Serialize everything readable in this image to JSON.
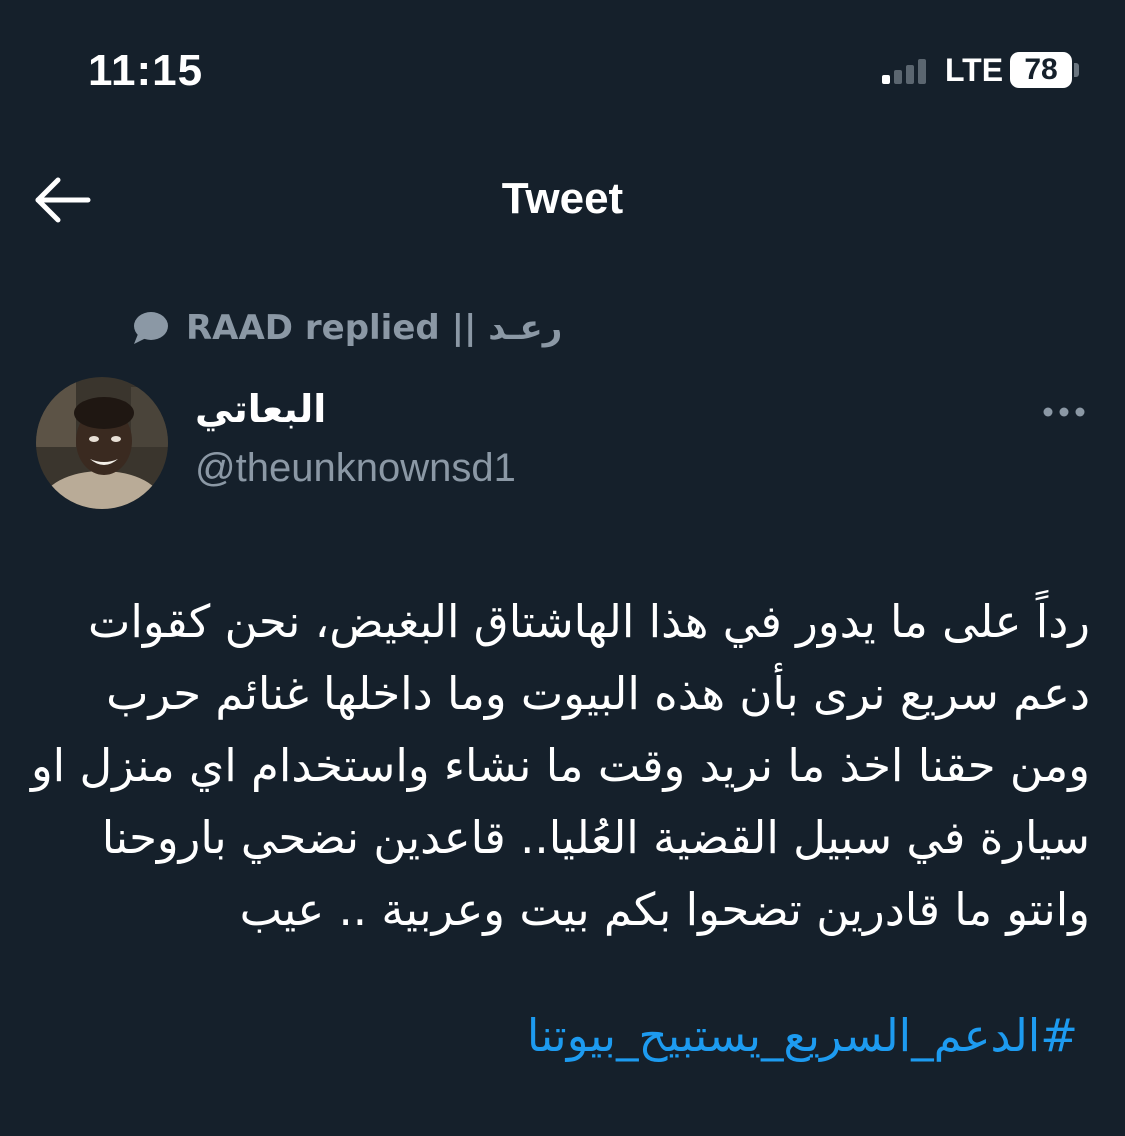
{
  "status_bar": {
    "time": "11:15",
    "network": "LTE",
    "battery": "78",
    "signal_bars_active": 1,
    "signal_bars_total": 4
  },
  "header": {
    "title": "Tweet",
    "back_icon": "arrow-left-icon"
  },
  "context": {
    "icon": "speech-bubble-icon",
    "text": "رعـد || RAAD replied"
  },
  "author": {
    "display_name": "البعاتي",
    "handle": "@theunknownsd1"
  },
  "tweet": {
    "text": "رداً على ما يدور في هذا الهاشتاق البغيض، نحن كقوات دعم سريع نرى بأن هذه البيوت وما داخلها غنائم حرب ومن حقنا اخذ ما نريد وقت ما نشاء واستخدام اي منزل او سيارة في سبيل القضية العُليا.. قاعدين نضحي باروحنا وانتو ما قادرين تضحوا بكم بيت وعربية .. عيب",
    "hashtag": "#الدعم_السريع_يستبيح_بيوتنا"
  },
  "colors": {
    "background": "#15202b",
    "text": "#ffffff",
    "secondary": "#8b98a5",
    "link": "#1d9bf0"
  }
}
